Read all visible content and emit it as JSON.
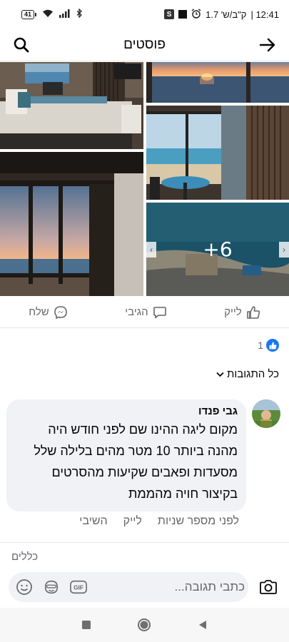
{
  "status_bar": {
    "battery": "41",
    "s_badge": "S",
    "carrier": "ק\"ב/ש' 1.7",
    "time": "12:41"
  },
  "header": {
    "title": "פוסטים",
    "back_icon": "arrow-right-icon",
    "search_icon": "search-icon"
  },
  "gallery": {
    "more_count": "+6"
  },
  "actions": {
    "like": "לייק",
    "comment": "הגיבי",
    "send": "שלח"
  },
  "reactions": {
    "count": "1"
  },
  "comments_filter": "כל התגובות",
  "comment": {
    "author": "גבי פנדו",
    "text": "מקום ליגה ההינו שם לפני חודש היה מהנה ביותר 10 מטר מהים בלילה שלל מסעדות ופאבים שקיעות מהסרטים בקיצור חויה מהממת",
    "time": "לפני מספר שניות",
    "like": "לייק",
    "reply": "השיבי"
  },
  "composer": {
    "rules": "כללים",
    "placeholder": "כתבי תגובה...",
    "gif_label": "GIF"
  },
  "colors": {
    "accent": "#1877f2",
    "secondary_text": "#65676b",
    "bubble_bg": "#f0f2f5"
  }
}
